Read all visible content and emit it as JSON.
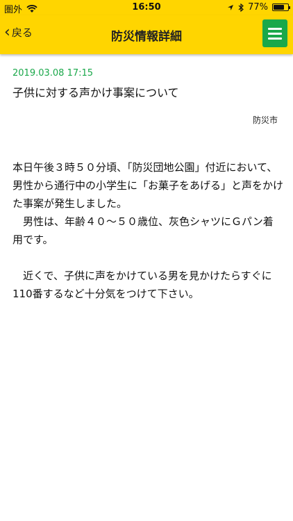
{
  "status_bar": {
    "carrier": "圏外",
    "time": "16:50",
    "battery_percent": "77%",
    "battery_level": 0.77
  },
  "nav": {
    "back_label": "戻る",
    "title": "防災情報詳細"
  },
  "article": {
    "date": "2019.03.08 17:15",
    "headline": "子供に対する声かけ事案について",
    "source": "防災市",
    "body": "本日午後３時５０分頃、「防災団地公園」付近において、男性から通行中の小学生に「お菓子をあげる」と声をかけた事案が発生しました。\n　男性は、年齢４０～５０歳位、灰色シャツにＧパン着用です。\n\n　近くで、子供に声をかけている男を見かけたらすぐに110番するなど十分気をつけて下さい。"
  },
  "colors": {
    "header_bg": "#ffd500",
    "menu_button": "#1aa84a",
    "date_text": "#1aa84a"
  }
}
